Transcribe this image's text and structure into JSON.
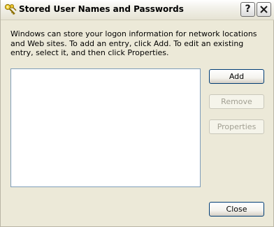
{
  "window": {
    "title": "Stored User Names and Passwords",
    "help_glyph": "?",
    "title_icon": "keys-icon",
    "close_icon": "close-icon"
  },
  "description": "Windows can store your logon information for network locations and Web sites. To add an entry, click Add. To edit an existing entry, select it, and then click Properties.",
  "credentials_list": {
    "items": []
  },
  "buttons": {
    "add": "Add",
    "remove": "Remove",
    "properties": "Properties",
    "close": "Close"
  },
  "colors": {
    "dialog_background": "#ece9d8",
    "listbox_border": "#7f9db9",
    "button_border": "#003c74",
    "disabled_text": "#a19f92"
  }
}
